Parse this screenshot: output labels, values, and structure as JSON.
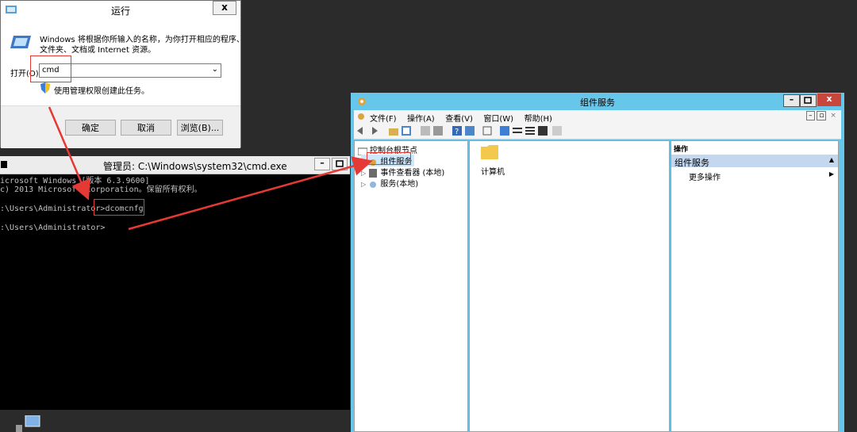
{
  "run_dialog": {
    "title": "运行",
    "close": "x",
    "desc_line1": "Windows 将根据你所输入的名称，为你打开相应的程序、",
    "desc_line2": "文件夹、文档或 Internet 资源。",
    "open_label": "打开(O):",
    "open_value": "cmd",
    "admin_note": "使用管理权限创建此任务。",
    "ok": "确定",
    "cancel": "取消",
    "browse": "浏览(B)..."
  },
  "cmd_window": {
    "title": "管理员: C:\\Windows\\system32\\cmd.exe",
    "line1": "icrosoft Windows [版本 6.3.9600]",
    "line2": "c) 2013 Microsoft Corporation。保留所有权利。",
    "line3_prompt": ":\\Users\\Administrator>",
    "line3_cmd": "dcomcnfg",
    "line4": ":\\Users\\Administrator>"
  },
  "component_services": {
    "title": "组件服务",
    "menu": [
      "文件(F)",
      "操作(A)",
      "查看(V)",
      "窗口(W)",
      "帮助(H)"
    ],
    "tree": {
      "root": "控制台根节点",
      "items": [
        "组件服务",
        "事件查看器 (本地)",
        "服务(本地)"
      ]
    },
    "middle_item": "计算机",
    "actions_header": "操作",
    "actions_section": "组件服务",
    "more_actions": "更多操作"
  },
  "colors": {
    "arrow": "#e53935",
    "title_blue": "#67c7ea",
    "close_red": "#c9463d",
    "selected": "#cce8ff"
  }
}
